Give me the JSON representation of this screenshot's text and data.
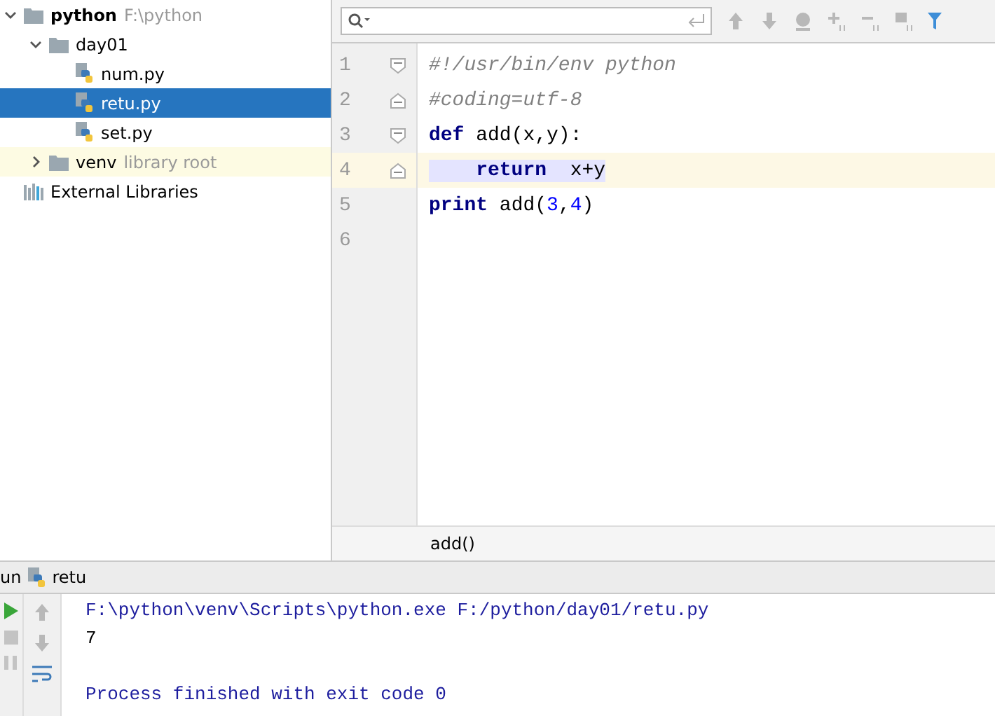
{
  "project_tree": [
    {
      "kind": "folder",
      "name": "python",
      "hint": "F:\\python",
      "bold": true,
      "expanded": true,
      "selected": false,
      "children": [
        {
          "kind": "folder",
          "name": "day01",
          "expanded": true,
          "selected": false,
          "children": [
            {
              "kind": "file",
              "name": "num.py",
              "selected": false
            },
            {
              "kind": "file",
              "name": "retu.py",
              "selected": true
            },
            {
              "kind": "file",
              "name": "set.py",
              "selected": false
            }
          ]
        },
        {
          "kind": "folder",
          "name": "venv",
          "hint": "library root",
          "expanded": false,
          "library_root": true,
          "selected": false
        }
      ]
    },
    {
      "kind": "library",
      "name": "External Libraries",
      "selected": false
    }
  ],
  "editor": {
    "lines": [
      {
        "number": "1",
        "kind": "fold_start",
        "current": false,
        "tokens": [
          {
            "kind": "comment",
            "text": "#!/usr/bin/env python"
          }
        ]
      },
      {
        "number": "2",
        "kind": "fold_end",
        "current": false,
        "tokens": [
          {
            "kind": "comment",
            "text": "#coding=utf-8"
          }
        ]
      },
      {
        "number": "3",
        "kind": "fold_start",
        "current": false,
        "tokens": [
          {
            "kind": "keyword",
            "text": "def"
          },
          {
            "kind": "plain",
            "text": " add(x,y):"
          }
        ]
      },
      {
        "number": "4",
        "kind": "fold_end",
        "current": true,
        "tokens": [
          {
            "kind": "highlight_keyword",
            "text": "    return"
          },
          {
            "kind": "highlight",
            "text": "  x+y"
          }
        ]
      },
      {
        "number": "5",
        "kind": "plain",
        "current": false,
        "tokens": [
          {
            "kind": "keyword",
            "text": "print"
          },
          {
            "kind": "plain",
            "text": " add("
          },
          {
            "kind": "number",
            "text": "3"
          },
          {
            "kind": "plain",
            "text": ","
          },
          {
            "kind": "number",
            "text": "4"
          },
          {
            "kind": "plain",
            "text": ")"
          }
        ]
      },
      {
        "number": "6",
        "kind": "plain",
        "current": false
      }
    ],
    "breadcrumb": "add()"
  },
  "run_panel": {
    "tab_label": "un",
    "config": "retu",
    "output": [
      {
        "kind": "command",
        "text": "F:\\python\\venv\\Scripts\\python.exe F:/python/day01/retu.py"
      },
      {
        "kind": "stdout",
        "text": "7"
      },
      {
        "kind": "blank"
      },
      {
        "kind": "command",
        "text": "Process finished with exit code 0"
      }
    ]
  }
}
